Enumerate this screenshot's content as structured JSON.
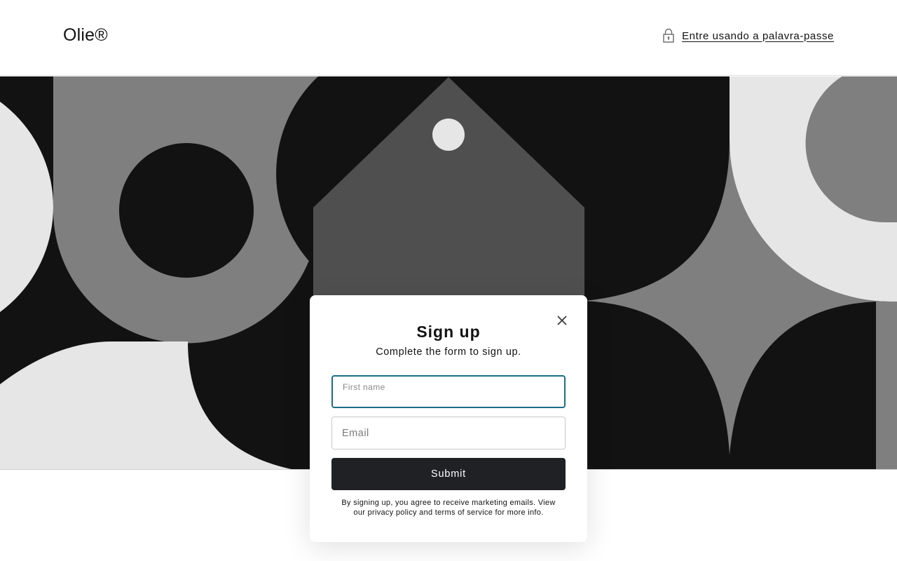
{
  "header": {
    "brand": "Olie®",
    "password_link": "Entre usando a palavra-passe",
    "lock_icon": "lock-icon"
  },
  "hero": {
    "colors": {
      "black": "#121212",
      "dark_gray": "#4f4f4f",
      "mid_gray": "#7f7f7f",
      "light_gray": "#e6e6e6"
    }
  },
  "signup_modal": {
    "title": "Sign up",
    "subtitle": "Complete the form to sign up.",
    "first_name_label": "First name",
    "first_name_value": "",
    "email_placeholder": "Email",
    "email_value": "",
    "submit_label": "Submit",
    "legal_text": "By signing up, you agree to receive marketing emails. View our privacy policy and terms of service for more info.",
    "close_icon": "close-icon",
    "accent_color": "#1c6e86",
    "button_color": "#202124"
  }
}
